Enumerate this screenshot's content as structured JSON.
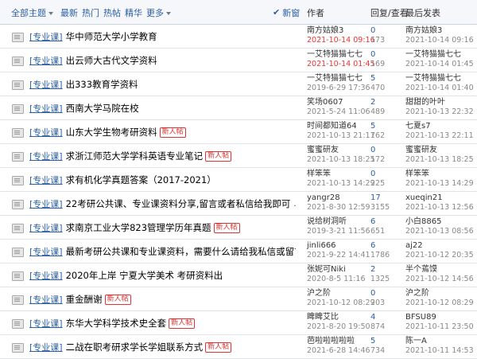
{
  "header": {
    "filters": {
      "all": "全部主题",
      "latest": "最新",
      "hot": "热门",
      "hot_posts": "热帖",
      "featured": "精华",
      "more": "更多"
    },
    "new_window": "新窗",
    "author_col": "作者",
    "replies_col": "回复/查看",
    "last_col": "最后发表"
  },
  "threads": [
    {
      "tag": "[专业课]",
      "title": "华中师范大学小学教育",
      "badge": "",
      "pages": "",
      "author": "南方姑娘3",
      "date": "2021-10-14 09:16",
      "date_hot": true,
      "replies": "0",
      "views": "173",
      "last_user": "南方姑娘3",
      "last_date": "2021-10-14 09:16"
    },
    {
      "tag": "[专业课]",
      "title": "出云师大古代文学资料",
      "badge": "",
      "pages": "",
      "author": "一艾特猫猫七七",
      "date": "2021-10-14 01:45",
      "date_hot": true,
      "replies": "0",
      "views": "169",
      "last_user": "一艾特猫猫七七",
      "last_date": "2021-10-14 01:45"
    },
    {
      "tag": "[专业课]",
      "title": "出333教育学资料",
      "badge": "",
      "pages": "",
      "author": "一艾特猫猫七七",
      "date": "2019-6-29 17:36",
      "date_hot": false,
      "replies": "5",
      "views": "470",
      "last_user": "一艾特猫猫七七",
      "last_date": "2021-10-14 01:40"
    },
    {
      "tag": "[专业课]",
      "title": "西南大学马院在校",
      "badge": "",
      "pages": "",
      "author": "笑场0607",
      "date": "2021-5-24 11:06",
      "date_hot": false,
      "replies": "2",
      "views": "489",
      "last_user": "甜甜的叶叶",
      "last_date": "2021-10-13 22:32"
    },
    {
      "tag": "[专业课]",
      "title": "山东大学生物考研资料",
      "badge": "新人帖",
      "pages": "",
      "author": "时间都知道64",
      "date": "2021-10-13 21:11",
      "date_hot": false,
      "replies": "5",
      "views": "762",
      "last_user": "七夏s7",
      "last_date": "2021-10-13 22:11"
    },
    {
      "tag": "[专业课]",
      "title": "求浙江师范大学学科英语专业笔记",
      "badge": "新人帖",
      "pages": "",
      "author": "蜜蜜研友",
      "date": "2021-10-13 18:25",
      "date_hot": false,
      "replies": "0",
      "views": "172",
      "last_user": "蜜蜜研友",
      "last_date": "2021-10-13 18:25"
    },
    {
      "tag": "[专业课]",
      "title": "求有机化学真题答案（2017-2021）",
      "badge": "",
      "pages": "",
      "author": "样笨笨",
      "date": "2021-10-13 14:29",
      "date_hot": false,
      "replies": "0",
      "views": "225",
      "last_user": "样笨笨",
      "last_date": "2021-10-13 14:29"
    },
    {
      "tag": "[专业课]",
      "title": "22考研公共课、专业课资料分享,留言或者私信给我即可",
      "badge": "",
      "pages": "... 2",
      "author": "yangr28",
      "date": "2021-8-30 12:59",
      "date_hot": false,
      "replies": "17",
      "views": "3155",
      "last_user": "xueqin21",
      "last_date": "2021-10-13 12:56"
    },
    {
      "tag": "[专业课]",
      "title": "求南京工业大学823管理学历年真题",
      "badge": "新人帖",
      "pages": "",
      "author": "说给树洞听",
      "date": "2019-3-21 11:56",
      "date_hot": false,
      "replies": "6",
      "views": "651",
      "last_user": "小白8865",
      "last_date": "2021-10-13 08:56"
    },
    {
      "tag": "[专业课]",
      "title": "最新考研公共课和专业课资料，需要什么请给我私信或留言",
      "badge": "",
      "pages": "",
      "author": "jinli666",
      "date": "2021-9-22 14:41",
      "date_hot": false,
      "replies": "6",
      "views": "1786",
      "last_user": "aj22",
      "last_date": "2021-10-12 20:35"
    },
    {
      "tag": "[专业课]",
      "title": "2020年上岸 宁夏大学美术 考研资料出",
      "badge": "",
      "pages": "",
      "author": "张妮可Niki",
      "date": "2020-8-5 11:16",
      "date_hot": false,
      "replies": "2",
      "views": "1325",
      "last_user": "半个蔫馍",
      "last_date": "2021-10-12 14:56"
    },
    {
      "tag": "[专业课]",
      "title": "重金酬谢",
      "badge": "新人帖",
      "pages": "",
      "author": "沪之阶",
      "date": "2021-10-12 08:29",
      "date_hot": false,
      "replies": "0",
      "views": "203",
      "last_user": "沪之阶",
      "last_date": "2021-10-12 08:29"
    },
    {
      "tag": "[专业课]",
      "title": "东华大学科学技术史全套",
      "badge": "新人帖",
      "pages": "",
      "author": "睥睥艾比",
      "date": "2021-8-20 19:50",
      "date_hot": false,
      "replies": "4",
      "views": "874",
      "last_user": "BFSU89",
      "last_date": "2021-10-11 23:50"
    },
    {
      "tag": "[专业课]",
      "title": "二战在职考研求学长学姐联系方式",
      "badge": "新人帖",
      "pages": "",
      "author": "芭啦啦啦啦啦",
      "date": "2021-6-28 14:46",
      "date_hot": false,
      "replies": "5",
      "views": "734",
      "last_user": "陈一A",
      "last_date": "2021-10-11 14:53"
    }
  ]
}
